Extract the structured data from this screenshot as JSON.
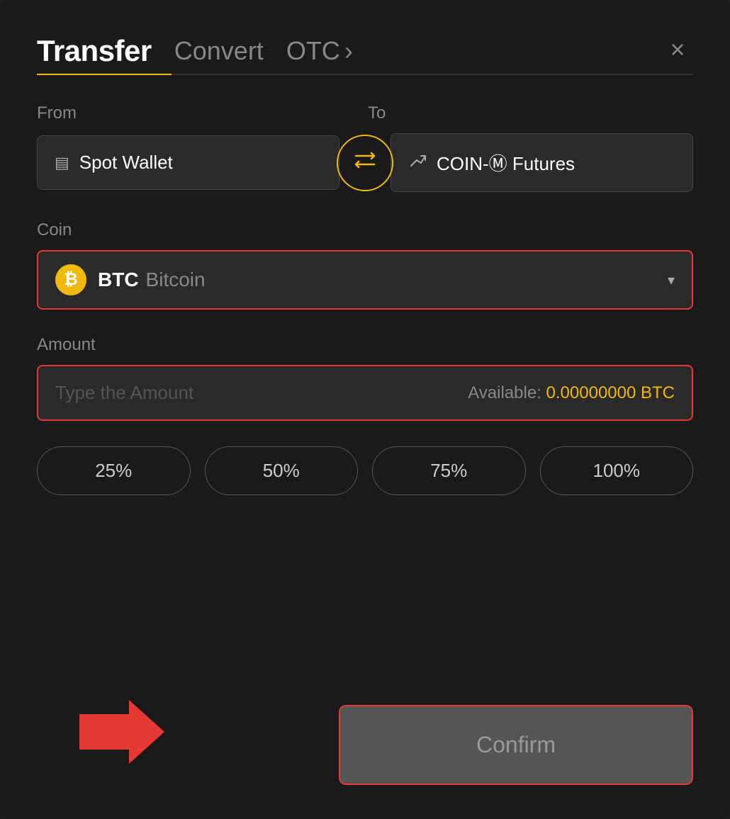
{
  "header": {
    "title": "Transfer",
    "nav": [
      {
        "label": "Convert",
        "active": false
      },
      {
        "label": "OTC",
        "active": false
      }
    ],
    "otc_chevron": "›",
    "close_label": "×"
  },
  "from_section": {
    "label": "From",
    "wallet_icon": "▤",
    "wallet_name": "Spot Wallet"
  },
  "to_section": {
    "label": "To",
    "futures_icon": "↑",
    "futures_name": "COIN-Ⓜ Futures"
  },
  "swap_icon": "⇄",
  "coin_section": {
    "label": "Coin",
    "coin_symbol": "BTC",
    "coin_name": "Bitcoin",
    "chevron": "▾"
  },
  "amount_section": {
    "label": "Amount",
    "placeholder": "Type the Amount",
    "available_label": "Available:",
    "available_amount": "0.00000000 BTC"
  },
  "pct_buttons": [
    {
      "label": "25%"
    },
    {
      "label": "50%"
    },
    {
      "label": "75%"
    },
    {
      "label": "100%"
    }
  ],
  "confirm_button": {
    "label": "Confirm"
  }
}
